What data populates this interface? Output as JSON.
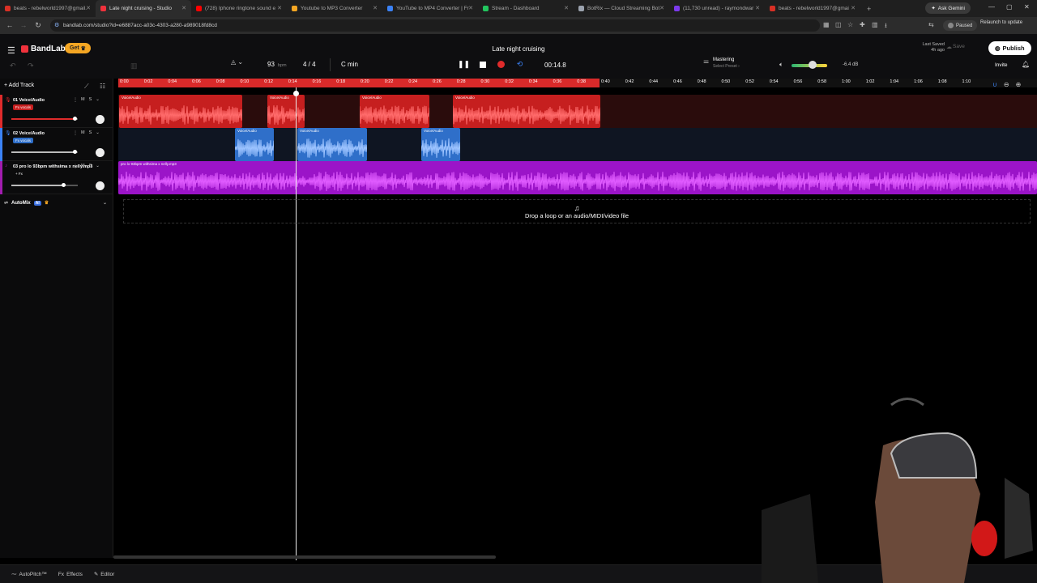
{
  "browser": {
    "tabs": [
      {
        "title": "beats - rebelworld1997@gmail.",
        "color": "#d93025"
      },
      {
        "title": "Late night cruising - Studio",
        "color": "#f0323c",
        "active": true
      },
      {
        "title": "(728) Iphone ringtone sound e",
        "color": "#ff0000"
      },
      {
        "title": "Youtube to MP3 Converter",
        "color": "#f4a623"
      },
      {
        "title": "YouTube to MP4 Converter | Fr",
        "color": "#3b82f6"
      },
      {
        "title": "Stream - Dashboard",
        "color": "#22c55e"
      },
      {
        "title": "BotRix — Cloud Streaming Bot",
        "color": "#9ca3af"
      },
      {
        "title": "(11,730 unread) - raymondwar",
        "color": "#7c3aed"
      },
      {
        "title": "beats - rebelworld1997@gmai",
        "color": "#d93025"
      }
    ],
    "ask_gemini": "Ask Gemini",
    "url": "bandlab.com/studio?id=e6887acc-a03c-4303-a280-a989018fd8cd",
    "paused_label": "Paused",
    "relaunch_label": "Relaunch to update"
  },
  "app": {
    "brand": "BandLab",
    "get_label": "Get",
    "project_title": "Late night cruising",
    "last_saved_label": "Last Saved",
    "last_saved_time": "4h ago",
    "save_label": "Save",
    "publish_label": "Publish",
    "invite_label": "Invite",
    "bpm": "93",
    "bpm_unit": "bpm",
    "time_signature": "4 / 4",
    "key": "C min",
    "timecode": "00:14.8",
    "mastering_label": "Mastering",
    "mastering_preset": "Select Preset",
    "volume_db": "-6.4 dB",
    "volume_level": 0.6
  },
  "tracks_panel": {
    "add_track_label": "Add Track",
    "tracks": [
      {
        "name": "01  Voice/Audio",
        "fx": "Fx vocals",
        "accent": "#e02b2b",
        "volume": 0.95
      },
      {
        "name": "02  Voice/Audio",
        "fx": "Fx vocals",
        "accent": "#3b82f6",
        "volume": 0.95
      },
      {
        "name": "03  pro lo 93bpm withsima x nelly.mp3",
        "fx": "+ Fx",
        "accent": "#a21caf",
        "volume": 0.78
      }
    ],
    "mute_label": "M",
    "solo_label": "S",
    "automix_label": "AutoMix",
    "automix_ai": "AI"
  },
  "timeline": {
    "ticks": [
      "0:00",
      "0:02",
      "0:04",
      "0:06",
      "0:08",
      "0:10",
      "0:12",
      "0:14",
      "0:16",
      "0:18",
      "0:20",
      "0:22",
      "0:24",
      "0:26",
      "0:28",
      "0:30",
      "0:32",
      "0:34",
      "0:36",
      "0:38",
      "0:40",
      "0:42",
      "0:44",
      "0:46",
      "0:48",
      "0:50",
      "0:52",
      "0:54",
      "0:56",
      "0:58",
      "1:00",
      "1:02",
      "1:04",
      "1:06",
      "1:08",
      "1:10"
    ],
    "clip_label": "Voice/Audio",
    "track3_clip_label": "pro lo 93bpm withsima x nelly.mp3",
    "drop_text": "Drop a loop or an audio/MIDI/video file"
  },
  "bottom_bar": {
    "autopitch": "AutoPitch™",
    "effects": "Effects",
    "editor": "Editor"
  },
  "colors": {
    "red_track": "#c61f1f",
    "blue_track": "#2f6fc9",
    "purple_track": "#9b14c8"
  }
}
